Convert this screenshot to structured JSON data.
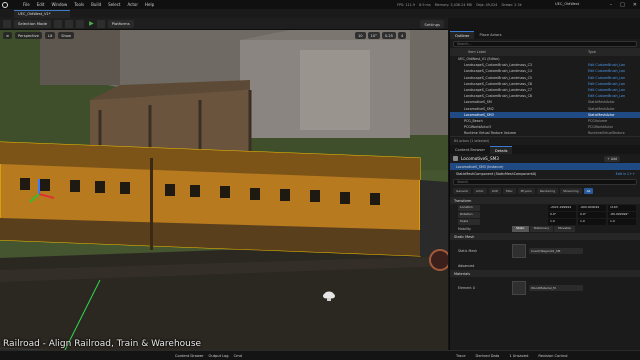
{
  "menu": [
    "File",
    "Edit",
    "Window",
    "Tools",
    "Build",
    "Select",
    "Actor",
    "Help"
  ],
  "stats": [
    "FPS: 111.9",
    "8.9 ms",
    "Memory: 3,436.24 MB",
    "Objs: 49,024",
    "Draws: 2.3k"
  ],
  "project_name": "UEC_OldWest",
  "window_controls": [
    "–",
    "□",
    "✕"
  ],
  "map_tab": "UEC_OldWest_V1*",
  "toolbar": {
    "selection_mode": "Selection Mode",
    "platforms": "Platforms",
    "settings": "Settings"
  },
  "viewport": {
    "perspective": "Perspective",
    "lit": "Lit",
    "show": "Show",
    "right_controls": [
      "10",
      "10°",
      "0.25",
      "4"
    ]
  },
  "outliner": {
    "tabs": [
      "Outliner",
      "Place Actors"
    ],
    "search_placeholder": "Search...",
    "col_label": "Item Label",
    "col_type": "Type",
    "rows": [
      {
        "label": "UEC_OldWest_V1 (Editor)",
        "type": "",
        "selected": false,
        "depth": 0
      },
      {
        "label": "LandscapeS_CustomBrush_Landmass_C3",
        "type": "Edit CustomBrush_Lan",
        "selected": false,
        "depth": 1
      },
      {
        "label": "LandscapeS_CustomBrush_Landmass_C4",
        "type": "Edit CustomBrush_Lan",
        "selected": false,
        "depth": 1
      },
      {
        "label": "LandscapeS_CustomBrush_Landmass_C5",
        "type": "Edit CustomBrush_Lan",
        "selected": false,
        "depth": 1
      },
      {
        "label": "LandscapeS_CustomBrush_Landmass_C6",
        "type": "Edit CustomBrush_Lan",
        "selected": false,
        "depth": 1
      },
      {
        "label": "LandscapeS_CustomBrush_Landmass_C7",
        "type": "Edit CustomBrush_Lan",
        "selected": false,
        "depth": 1
      },
      {
        "label": "LandscapeS_CustomBrush_Landmass_C8",
        "type": "Edit CustomBrush_Lan",
        "selected": false,
        "depth": 1
      },
      {
        "label": "LocomotiveS_SM",
        "type": "StaticMeshActor",
        "selected": false,
        "depth": 1
      },
      {
        "label": "LocomotiveS_SM2",
        "type": "StaticMeshActor",
        "selected": false,
        "depth": 1
      },
      {
        "label": "LocomotiveS_SM3",
        "type": "StaticMeshActor",
        "selected": true,
        "depth": 1
      },
      {
        "label": "PCG_Beach",
        "type": "PCGVolume",
        "selected": false,
        "depth": 1
      },
      {
        "label": "PCGWorldActor3",
        "type": "PCGWorldActor",
        "selected": false,
        "depth": 1
      },
      {
        "label": "Runtime Virtual Texture Volume",
        "type": "RuntimeVirtualTexture",
        "selected": false,
        "depth": 1
      }
    ],
    "count": "84 actors (1 selected)"
  },
  "details": {
    "tabs": [
      "Content Browser",
      "Details"
    ],
    "actor_name": "LocomotiveS_SM3",
    "add_label": "+ Add",
    "components": [
      {
        "label": "LocomotiveS_SM3 (Instance)",
        "selected": true,
        "edit": ""
      },
      {
        "label": "StaticMeshComponent (StaticMeshComponent0)",
        "selected": false,
        "edit": "Edit in C++"
      }
    ],
    "search_placeholder": "Search",
    "categories": [
      "General",
      "Actor",
      "LOD",
      "Misc",
      "Physics",
      "Rendering",
      "Streaming",
      "All"
    ],
    "transform_title": "Transform",
    "location_label": "Location",
    "location": [
      "-2021.999999",
      "-900.000049",
      "1163"
    ],
    "rotation_label": "Rotation",
    "rotation": [
      "0.0°",
      "0.0°",
      "-89.999999°"
    ],
    "scale_label": "Scale",
    "scale": [
      "1.0",
      "1.0",
      "1.0"
    ],
    "mobility_label": "Mobility",
    "mobility": [
      "Static",
      "Stationary",
      "Movable"
    ],
    "static_mesh_section": "Static Mesh",
    "static_mesh_label": "Static Mesh",
    "static_mesh_value": "CoachWagon01_SM",
    "advanced_label": "Advanced",
    "materials_section": "Materials",
    "element_label": "Element 0",
    "material_value": "WoodMaterial_M"
  },
  "bottom": {
    "content_drawer": "Content Drawer",
    "output_log": "Output Log",
    "cmd": "Cmd",
    "right": [
      "Trace",
      "Derived Data",
      "1 Unsaved",
      "Revision Control"
    ]
  },
  "caption": "Railroad - Align Railroad, Train & Warehouse"
}
